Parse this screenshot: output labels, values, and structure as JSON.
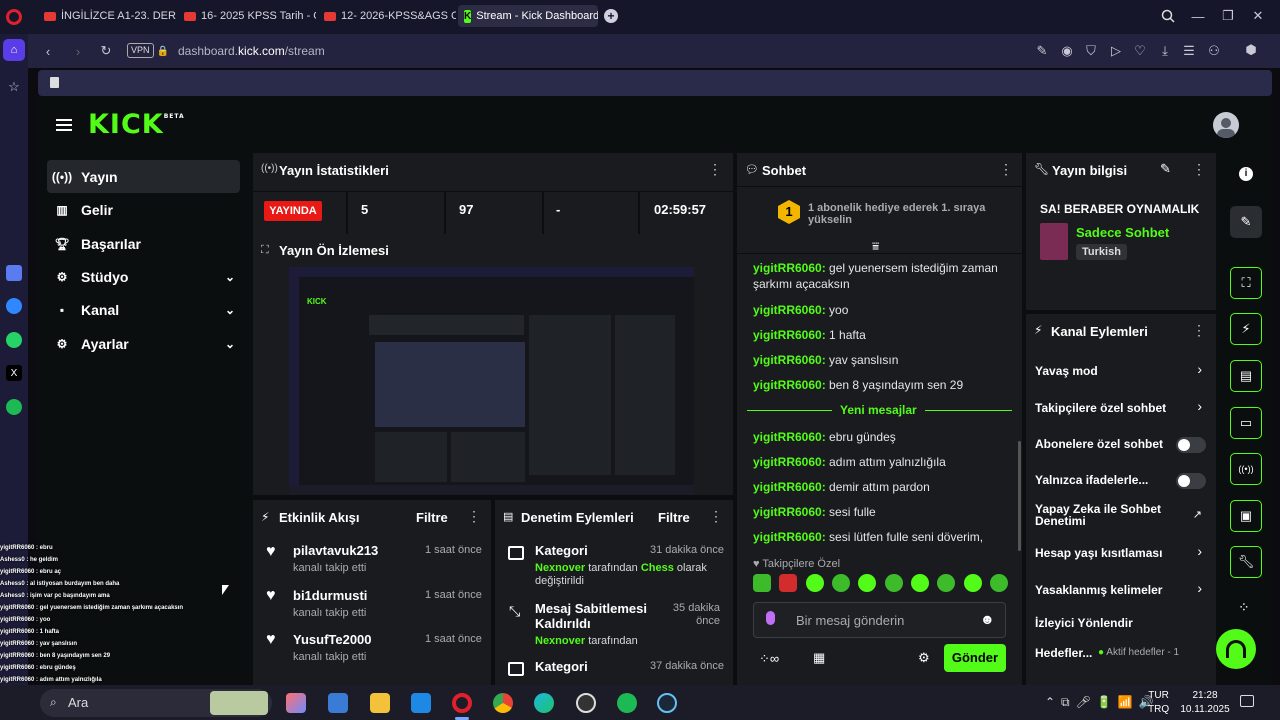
{
  "browser": {
    "tabs": [
      {
        "label": "İNGİLİZCE A1-23. DERS \"A",
        "type": "youtube"
      },
      {
        "label": "16- 2025 KPSS Tarih - Osm",
        "type": "youtube"
      },
      {
        "label": "12- 2026-KPSS&AGS COĞ",
        "type": "youtube"
      },
      {
        "label": "Stream - Kick Dashboard",
        "type": "kick"
      }
    ],
    "vpn_label": "VPN",
    "url_prefix": "dashboard.",
    "url_domain": "kick.com",
    "url_path": "/stream"
  },
  "kick": {
    "logo": "KICK",
    "logo_sup": "BETA",
    "nav": [
      {
        "label": "Yayın",
        "icon": "broadcast-icon"
      },
      {
        "label": "Gelir",
        "icon": "chart-icon"
      },
      {
        "label": "Başarılar",
        "icon": "trophy-icon"
      },
      {
        "label": "Stüdyo",
        "icon": "studio-icon"
      },
      {
        "label": "Kanal",
        "icon": "channel-icon"
      },
      {
        "label": "Ayarlar",
        "icon": "settings-icon"
      }
    ],
    "stats": {
      "title": "Yayın İstatistikleri",
      "live_badge": "YAYINDA",
      "followers": "5",
      "viewers": "97",
      "dash": "-",
      "uptime": "02:59:57"
    },
    "preview": {
      "title": "Yayın Ön İzlemesi"
    },
    "activity": {
      "title": "Etkinlik Akışı",
      "filter": "Filtre",
      "items": [
        {
          "user": "pilavtavuk213",
          "action": "kanalı takip etti",
          "time": "1 saat önce"
        },
        {
          "user": "bi1durmusti",
          "action": "kanalı takip etti",
          "time": "1 saat önce"
        },
        {
          "user": "YusufTe2000",
          "action": "kanalı takip etti",
          "time": "1 saat önce"
        }
      ]
    },
    "moderation": {
      "title": "Denetim Eylemleri",
      "filter": "Filtre",
      "items": [
        {
          "title": "Kategori",
          "time": "31 dakika önce",
          "user": "Nexnover",
          "mid": "tarafından",
          "target": "Chess",
          "rest": "olarak değiştirildi"
        },
        {
          "title": "Mesaj Sabitlemesi Kaldırıldı",
          "time": "35 dakika önce",
          "user": "Nexnover",
          "mid": "tarafından",
          "target": "",
          "rest": ""
        },
        {
          "title": "Kategori",
          "time": "37 dakika önce",
          "user": "",
          "mid": "",
          "target": "",
          "rest": ""
        }
      ]
    },
    "chat": {
      "title": "Sohbet",
      "gift_text": "1 abonelik hediye ederek 1. sıraya yükselin",
      "gift_rank": "1",
      "new_messages": "Yeni mesajlar",
      "messages_before": [
        {
          "user": "yigitRR6060:",
          "text": "gel yuenersem istediğim zaman şarkımı açacaksın"
        },
        {
          "user": "yigitRR6060:",
          "text": "yoo"
        },
        {
          "user": "yigitRR6060:",
          "text": "1 hafta"
        },
        {
          "user": "yigitRR6060:",
          "text": "yav şanslısın"
        },
        {
          "user": "yigitRR6060:",
          "text": "ben 8 yaşındayım sen 29"
        }
      ],
      "messages_after": [
        {
          "user": "yigitRR6060:",
          "text": "ebru gündeş"
        },
        {
          "user": "yigitRR6060:",
          "text": "adım attım yalnızlığıla"
        },
        {
          "user": "yigitRR6060:",
          "text": "demir attım pardon"
        },
        {
          "user": "yigitRR6060:",
          "text": "sesi fulle"
        },
        {
          "user": "yigitRR6060:",
          "text": "sesi lütfen fulle seni döverim,"
        }
      ],
      "followers_only": "Takipçilere Özel",
      "input_placeholder": "Bir mesaj gönderin",
      "send": "Gönder"
    },
    "stream_info": {
      "title": "Yayın bilgisi",
      "stream_title": "SA! BERABER OYNAMALIK",
      "category": "Sadece Sohbet",
      "language": "Turkish"
    },
    "channel_actions": {
      "title": "Kanal Eylemleri",
      "items": [
        {
          "label": "Yavaş mod",
          "control": "arrow"
        },
        {
          "label": "Takipçilere özel sohbet",
          "control": "arrow"
        },
        {
          "label": "Abonelere özel sohbet",
          "control": "toggle"
        },
        {
          "label": "Yalnızca ifadelerle...",
          "control": "toggle"
        },
        {
          "label": "Yapay Zeka ile Sohbet Denetimi",
          "control": "external"
        },
        {
          "label": "Hesap yaşı kısıtlaması",
          "control": "arrow"
        },
        {
          "label": "Yasaklanmış kelimeler",
          "control": "arrow"
        },
        {
          "label": "İzleyici Yönlendir",
          "control": "none"
        },
        {
          "label": "Hedefler...",
          "control": "none"
        }
      ],
      "goals_status": "Aktif hedefler - 1"
    }
  },
  "overlay_chat": [
    "yigitRR6060 : ebru",
    "Ashess0 : he geldim",
    "yigitRR6060 : ebru aç",
    "Ashess0 : al istiyosan burdayım ben daha",
    "Ashess0 : işim var pc başındayım ama",
    "yigitRR6060 : gel yuenersem istediğim zaman şarkımı açacaksın",
    "yigitRR6060 : yoo",
    "yigitRR6060 : 1 hafta",
    "yigitRR6060 : yav şanslısın",
    "yigitRR6060 : ben 8 yaşındayım sen 29",
    "yigitRR6060 : ebru gündeş",
    "yigitRR6060 : adım attım yalnızlığıla"
  ],
  "taskbar": {
    "search": "Ara",
    "lang1": "TUR",
    "lang2": "TRQ",
    "time": "21:28",
    "date": "10.11.2025"
  }
}
